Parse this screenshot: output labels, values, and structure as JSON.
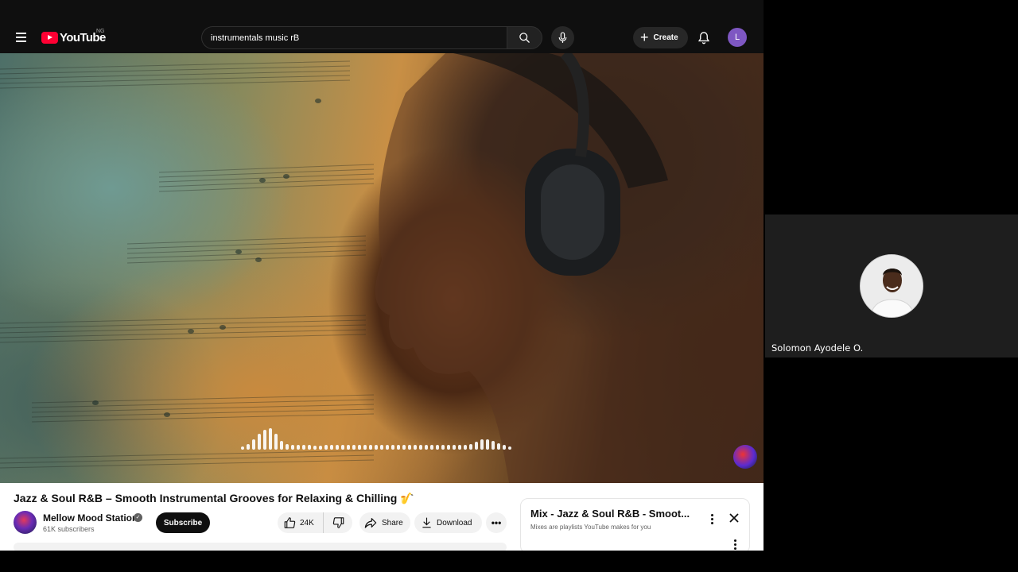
{
  "youtube": {
    "header": {
      "logo_text": "YouTube",
      "region": "NG",
      "search_value": "instrumentals music rB",
      "create_label": "Create",
      "account_initial": "L",
      "account_color": "#7e57c2"
    },
    "video": {
      "title": "Jazz & Soul R&B – Smooth Instrumental Grooves for Relaxing & Chilling 🎷",
      "visualizer_levels": [
        0.15,
        0.25,
        0.45,
        0.7,
        0.9,
        0.95,
        0.7,
        0.4,
        0.25,
        0.2,
        0.2,
        0.2,
        0.2,
        0.18,
        0.18,
        0.2,
        0.2,
        0.2,
        0.2,
        0.22,
        0.2,
        0.2,
        0.2,
        0.2,
        0.2,
        0.2,
        0.2,
        0.2,
        0.2,
        0.2,
        0.22,
        0.2,
        0.2,
        0.2,
        0.2,
        0.2,
        0.2,
        0.2,
        0.2,
        0.2,
        0.2,
        0.25,
        0.35,
        0.45,
        0.45,
        0.4,
        0.3,
        0.2,
        0.15
      ]
    },
    "channel": {
      "name": "Mellow Mood Station",
      "verified_mark": "✓",
      "subscribers": "61K subscribers",
      "subscribe_label": "Subscribe"
    },
    "actions": {
      "like_count": "24K",
      "share_label": "Share",
      "download_label": "Download",
      "more_label": "•••"
    },
    "mix": {
      "title": "Mix - Jazz & Soul R&B - Smoot...",
      "subtitle": "Mixes are playlists YouTube makes for you"
    }
  },
  "call": {
    "participant_name": "Solomon Ayodele O."
  }
}
